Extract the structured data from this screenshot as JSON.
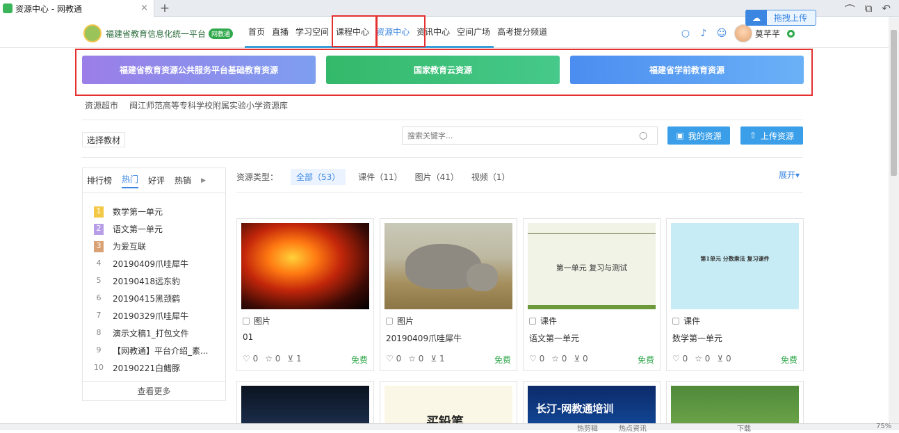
{
  "browser": {
    "tab_title": "资源中心 - 网教通",
    "tab_close": "×",
    "new_tab": "+",
    "controls": [
      "⌒",
      "⧉",
      "↶"
    ],
    "upload_float": "拖拽上传"
  },
  "header": {
    "logo_text": "福建省教育信息化统一平台",
    "logo_badge": "网教通",
    "nav": [
      "首页",
      "直播",
      "学习空间",
      "课程中心",
      "资源中心",
      "资讯中心",
      "空间广场",
      "高考提分频道"
    ],
    "user_name": "莫芊芊"
  },
  "banners": [
    "福建省教育资源公共服务平台基础教育资源",
    "国家教育云资源",
    "福建省学前教育资源"
  ],
  "breadcrumbs": [
    "资源超市",
    "闽江师范高等专科学校附属实验小学资源库"
  ],
  "toolbar": {
    "textbook_button": "选择教材",
    "search_placeholder": "搜索关键字...",
    "my_resources": "我的资源",
    "upload": "上传资源"
  },
  "ranking": {
    "label": "排行榜",
    "tabs": [
      "热门",
      "好评",
      "热销"
    ],
    "items": [
      {
        "rank": "1",
        "name": "数学第一单元"
      },
      {
        "rank": "2",
        "name": "语文第一单元"
      },
      {
        "rank": "3",
        "name": "为爱互联"
      },
      {
        "rank": "4",
        "name": "20190409爪哇犀牛"
      },
      {
        "rank": "5",
        "name": "20190418远东豹"
      },
      {
        "rank": "6",
        "name": "20190415黑颈鹤"
      },
      {
        "rank": "7",
        "name": "20190329爪哇犀牛"
      },
      {
        "rank": "8",
        "name": "演示文稿1_打包文件"
      },
      {
        "rank": "9",
        "name": "【网教通】平台介绍_素..."
      },
      {
        "rank": "10",
        "name": "20190221白鳍豚"
      }
    ],
    "more": "查看更多"
  },
  "filter": {
    "label": "资源类型：",
    "options": [
      "全部（53）",
      "课件（11）",
      "图片（41）",
      "视频（1）"
    ],
    "expand": "展开▾"
  },
  "cards": [
    {
      "type": "图片",
      "title": "01",
      "likes": "0",
      "favs": "0",
      "downloads": "1",
      "price": "免费"
    },
    {
      "type": "图片",
      "title": "20190409爪哇犀牛",
      "likes": "0",
      "favs": "0",
      "downloads": "1",
      "price": "免费"
    },
    {
      "type": "课件",
      "title": "语文第一单元",
      "likes": "0",
      "favs": "0",
      "downloads": "0",
      "price": "免费",
      "thumb_text": "第一单元 复习与测试"
    },
    {
      "type": "课件",
      "title": "数学第一单元",
      "likes": "0",
      "favs": "0",
      "downloads": "0",
      "price": "免费",
      "thumb_text": "第1单元 分数乘法 复习课件"
    }
  ],
  "cards_row2": [
    {
      "thumb_text": ""
    },
    {
      "thumb_text": "买铅笔"
    },
    {
      "thumb_text": "长汀-网教通培训"
    },
    {
      "thumb_text": ""
    }
  ],
  "statusbar": {
    "items": [
      "热剪辑",
      "热点资讯",
      "下载",
      "75%"
    ]
  }
}
